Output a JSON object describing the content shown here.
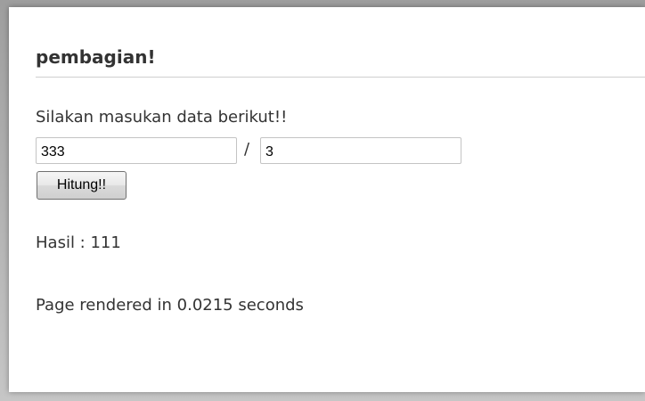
{
  "page": {
    "title": "pembagian!",
    "intro": "Silakan masukan data berikut!!"
  },
  "form": {
    "dividend_value": "333",
    "divider_symbol": "/",
    "divisor_value": "3",
    "submit_label": "Hitung!!"
  },
  "result": {
    "label": "Hasil : ",
    "value": "111"
  },
  "footer": {
    "render_text": "Page rendered in 0.0215 seconds"
  }
}
